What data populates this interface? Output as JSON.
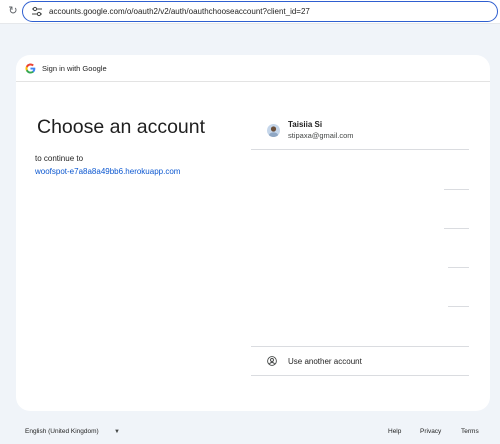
{
  "browser": {
    "url": "accounts.google.com/o/oauth2/v2/auth/oauthchooseaccount?client_id=27"
  },
  "header": {
    "title": "Sign in with Google"
  },
  "main": {
    "title": "Choose an account",
    "continue_text": "to continue to",
    "app_name": "woofspot-e7a8a8a49bb6.herokuapp.com"
  },
  "accounts": [
    {
      "name": "Taisiia Si",
      "email": "stipaxa@gmail.com"
    }
  ],
  "use_another_label": "Use another account",
  "footer": {
    "language": "English (United Kingdom)",
    "help": "Help",
    "privacy": "Privacy",
    "terms": "Terms"
  },
  "colors": {
    "link": "#0b57d0",
    "background": "#f0f4f9",
    "omnibox_border": "#2f5fd0"
  },
  "icons": [
    "reload-icon",
    "site-info-icon",
    "google-logo-icon",
    "avatar",
    "person-circle-icon",
    "chevron-down-icon"
  ]
}
